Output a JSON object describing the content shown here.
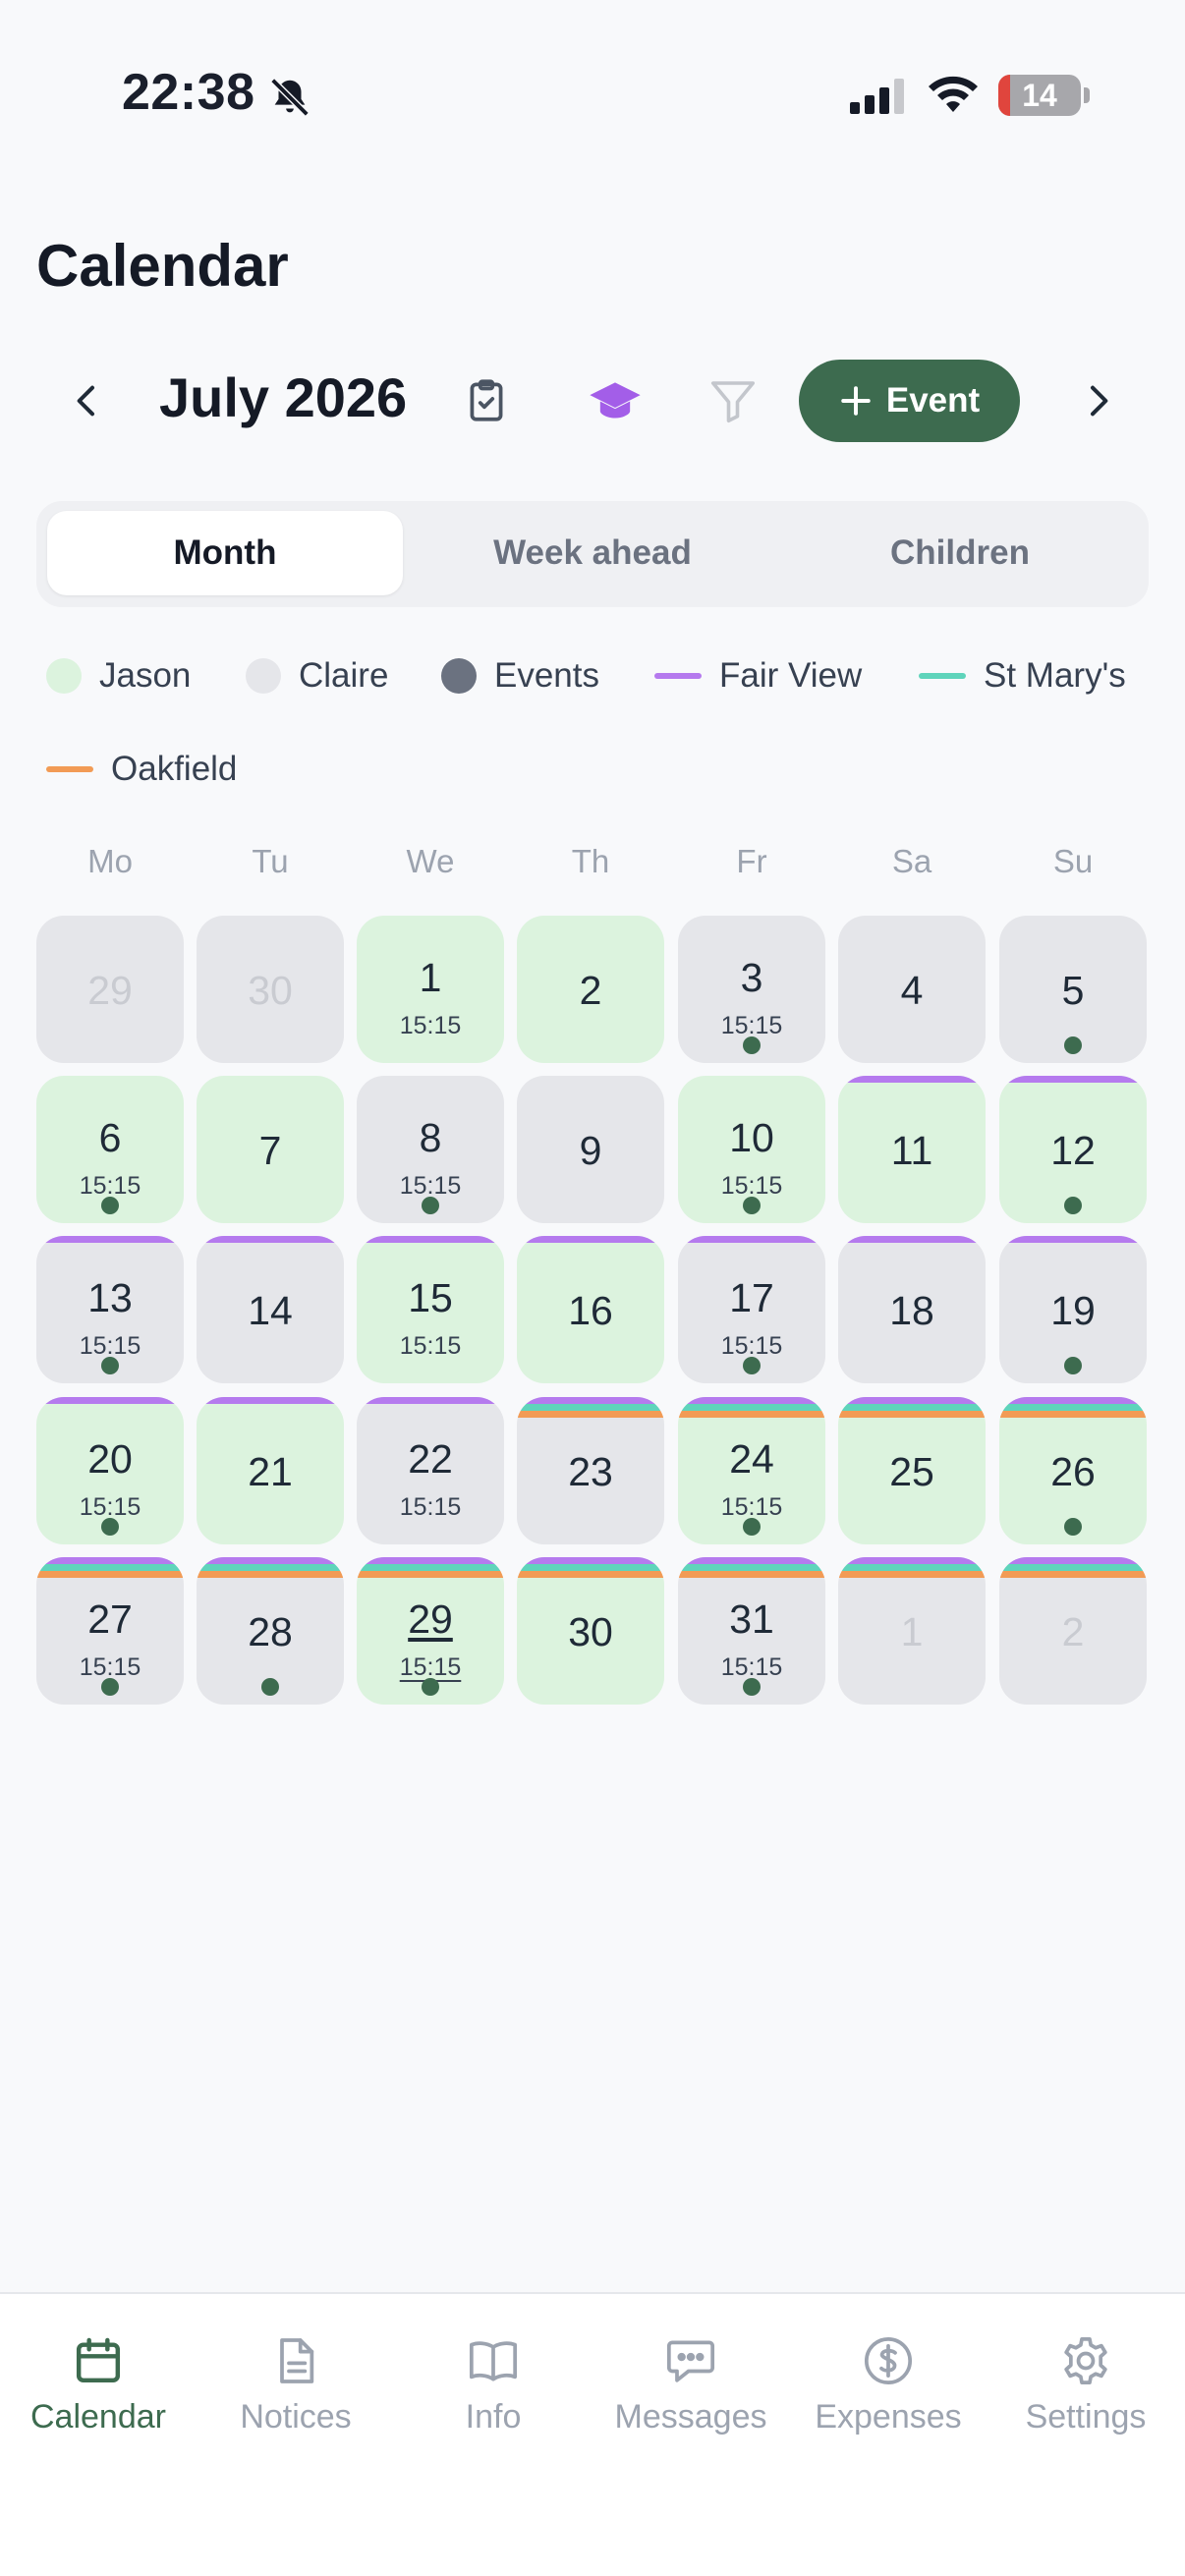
{
  "status_bar": {
    "time": "22:38",
    "battery": "14"
  },
  "page": {
    "title": "Calendar"
  },
  "header": {
    "month": "July 2026",
    "add_event_label": "Event"
  },
  "view_tabs": [
    "Month",
    "Week ahead",
    "Children"
  ],
  "active_view": "Month",
  "legend": [
    {
      "label": "Jason",
      "kind": "dot",
      "color": "#dcf3de"
    },
    {
      "label": "Claire",
      "kind": "dot",
      "color": "#e5e6ea"
    },
    {
      "label": "Events",
      "kind": "dot",
      "color": "#6b7280"
    },
    {
      "label": "Fair View",
      "kind": "line",
      "color": "#b57aee"
    },
    {
      "label": "St Mary's",
      "kind": "line",
      "color": "#5fd4bb"
    },
    {
      "label": "Oakfield",
      "kind": "line",
      "color": "#f29b55"
    }
  ],
  "weekdays": [
    "Mo",
    "Tu",
    "We",
    "Th",
    "Fr",
    "Sa",
    "Su"
  ],
  "days": [
    {
      "day": "29",
      "parent": "gray",
      "muted": true,
      "time": "",
      "dot": false,
      "schools": []
    },
    {
      "day": "30",
      "parent": "gray",
      "muted": true,
      "time": "",
      "dot": false,
      "schools": []
    },
    {
      "day": "1",
      "parent": "green",
      "muted": false,
      "time": "15:15",
      "dot": false,
      "schools": []
    },
    {
      "day": "2",
      "parent": "green",
      "muted": false,
      "time": "",
      "dot": false,
      "schools": []
    },
    {
      "day": "3",
      "parent": "gray",
      "muted": false,
      "time": "15:15",
      "dot": true,
      "schools": []
    },
    {
      "day": "4",
      "parent": "gray",
      "muted": false,
      "time": "",
      "dot": false,
      "schools": []
    },
    {
      "day": "5",
      "parent": "gray",
      "muted": false,
      "time": "",
      "dot": true,
      "schools": []
    },
    {
      "day": "6",
      "parent": "green",
      "muted": false,
      "time": "15:15",
      "dot": true,
      "schools": []
    },
    {
      "day": "7",
      "parent": "green",
      "muted": false,
      "time": "",
      "dot": false,
      "schools": []
    },
    {
      "day": "8",
      "parent": "gray",
      "muted": false,
      "time": "15:15",
      "dot": true,
      "schools": []
    },
    {
      "day": "9",
      "parent": "gray",
      "muted": false,
      "time": "",
      "dot": false,
      "schools": []
    },
    {
      "day": "10",
      "parent": "green",
      "muted": false,
      "time": "15:15",
      "dot": true,
      "schools": []
    },
    {
      "day": "11",
      "parent": "green",
      "muted": false,
      "time": "",
      "dot": false,
      "schools": [
        "fairview"
      ]
    },
    {
      "day": "12",
      "parent": "green",
      "muted": false,
      "time": "",
      "dot": true,
      "schools": [
        "fairview"
      ]
    },
    {
      "day": "13",
      "parent": "gray",
      "muted": false,
      "time": "15:15",
      "dot": true,
      "schools": [
        "fairview"
      ]
    },
    {
      "day": "14",
      "parent": "gray",
      "muted": false,
      "time": "",
      "dot": false,
      "schools": [
        "fairview"
      ]
    },
    {
      "day": "15",
      "parent": "green",
      "muted": false,
      "time": "15:15",
      "dot": false,
      "schools": [
        "fairview"
      ]
    },
    {
      "day": "16",
      "parent": "green",
      "muted": false,
      "time": "",
      "dot": false,
      "schools": [
        "fairview"
      ]
    },
    {
      "day": "17",
      "parent": "gray",
      "muted": false,
      "time": "15:15",
      "dot": true,
      "schools": [
        "fairview"
      ]
    },
    {
      "day": "18",
      "parent": "gray",
      "muted": false,
      "time": "",
      "dot": false,
      "schools": [
        "fairview"
      ]
    },
    {
      "day": "19",
      "parent": "gray",
      "muted": false,
      "time": "",
      "dot": true,
      "schools": [
        "fairview"
      ]
    },
    {
      "day": "20",
      "parent": "green",
      "muted": false,
      "time": "15:15",
      "dot": true,
      "schools": [
        "fairview"
      ]
    },
    {
      "day": "21",
      "parent": "green",
      "muted": false,
      "time": "",
      "dot": false,
      "schools": [
        "fairview"
      ]
    },
    {
      "day": "22",
      "parent": "gray",
      "muted": false,
      "time": "15:15",
      "dot": false,
      "schools": [
        "fairview"
      ]
    },
    {
      "day": "23",
      "parent": "gray",
      "muted": false,
      "time": "",
      "dot": false,
      "schools": [
        "fairview",
        "stmarys",
        "oakfield"
      ]
    },
    {
      "day": "24",
      "parent": "green",
      "muted": false,
      "time": "15:15",
      "dot": true,
      "schools": [
        "fairview",
        "stmarys",
        "oakfield"
      ]
    },
    {
      "day": "25",
      "parent": "green",
      "muted": false,
      "time": "",
      "dot": false,
      "schools": [
        "fairview",
        "stmarys",
        "oakfield"
      ]
    },
    {
      "day": "26",
      "parent": "green",
      "muted": false,
      "time": "",
      "dot": true,
      "schools": [
        "fairview",
        "stmarys",
        "oakfield"
      ]
    },
    {
      "day": "27",
      "parent": "gray",
      "muted": false,
      "time": "15:15",
      "dot": true,
      "schools": [
        "fairview",
        "stmarys",
        "oakfield"
      ]
    },
    {
      "day": "28",
      "parent": "gray",
      "muted": false,
      "time": "",
      "dot": true,
      "schools": [
        "fairview",
        "stmarys",
        "oakfield"
      ]
    },
    {
      "day": "29",
      "parent": "green",
      "muted": false,
      "time": "15:15",
      "dot": true,
      "today": true,
      "schools": [
        "fairview",
        "stmarys",
        "oakfield"
      ]
    },
    {
      "day": "30",
      "parent": "green",
      "muted": false,
      "time": "",
      "dot": false,
      "schools": [
        "fairview",
        "stmarys",
        "oakfield"
      ]
    },
    {
      "day": "31",
      "parent": "gray",
      "muted": false,
      "time": "15:15",
      "dot": true,
      "schools": [
        "fairview",
        "stmarys",
        "oakfield"
      ]
    },
    {
      "day": "1",
      "parent": "gray",
      "muted": true,
      "time": "",
      "dot": false,
      "schools": [
        "fairview",
        "stmarys",
        "oakfield"
      ]
    },
    {
      "day": "2",
      "parent": "gray",
      "muted": true,
      "time": "",
      "dot": false,
      "schools": [
        "fairview",
        "stmarys",
        "oakfield"
      ]
    }
  ],
  "school_colors": {
    "fairview": "#b57aee",
    "stmarys": "#5fd4bb",
    "oakfield": "#f29b55"
  },
  "tabbar": [
    {
      "label": "Calendar",
      "icon": "calendar-icon",
      "active": true
    },
    {
      "label": "Notices",
      "icon": "document-icon",
      "active": false
    },
    {
      "label": "Info",
      "icon": "book-icon",
      "active": false
    },
    {
      "label": "Messages",
      "icon": "message-icon",
      "active": false
    },
    {
      "label": "Expenses",
      "icon": "dollar-icon",
      "active": false
    },
    {
      "label": "Settings",
      "icon": "gear-icon",
      "active": false
    }
  ]
}
